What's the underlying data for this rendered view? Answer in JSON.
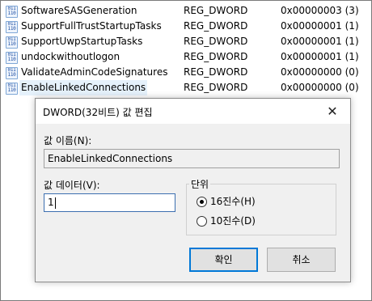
{
  "registry": {
    "rows": [
      {
        "name": "SoftwareSASGeneration",
        "type": "REG_DWORD",
        "data": "0x00000003 (3)"
      },
      {
        "name": "SupportFullTrustStartupTasks",
        "type": "REG_DWORD",
        "data": "0x00000001 (1)"
      },
      {
        "name": "SupportUwpStartupTasks",
        "type": "REG_DWORD",
        "data": "0x00000001 (1)"
      },
      {
        "name": "undockwithoutlogon",
        "type": "REG_DWORD",
        "data": "0x00000001 (1)"
      },
      {
        "name": "ValidateAdminCodeSignatures",
        "type": "REG_DWORD",
        "data": "0x00000000 (0)"
      },
      {
        "name": "EnableLinkedConnections",
        "type": "REG_DWORD",
        "data": "0x00000000 (0)"
      }
    ],
    "icon": "dword-value-icon",
    "icon_glyph_top": "011",
    "icon_glyph_bottom": "110"
  },
  "dialog": {
    "title": "DWORD(32비트) 값 편집",
    "close_glyph": "✕",
    "name_label": "값 이름(N):",
    "name_value": "EnableLinkedConnections",
    "data_label": "값 데이터(V):",
    "data_value": "1",
    "base_label": "단위",
    "base_options": [
      {
        "label": "16진수(H)",
        "selected": true
      },
      {
        "label": "10진수(D)",
        "selected": false
      }
    ],
    "ok_label": "확인",
    "cancel_label": "취소"
  }
}
